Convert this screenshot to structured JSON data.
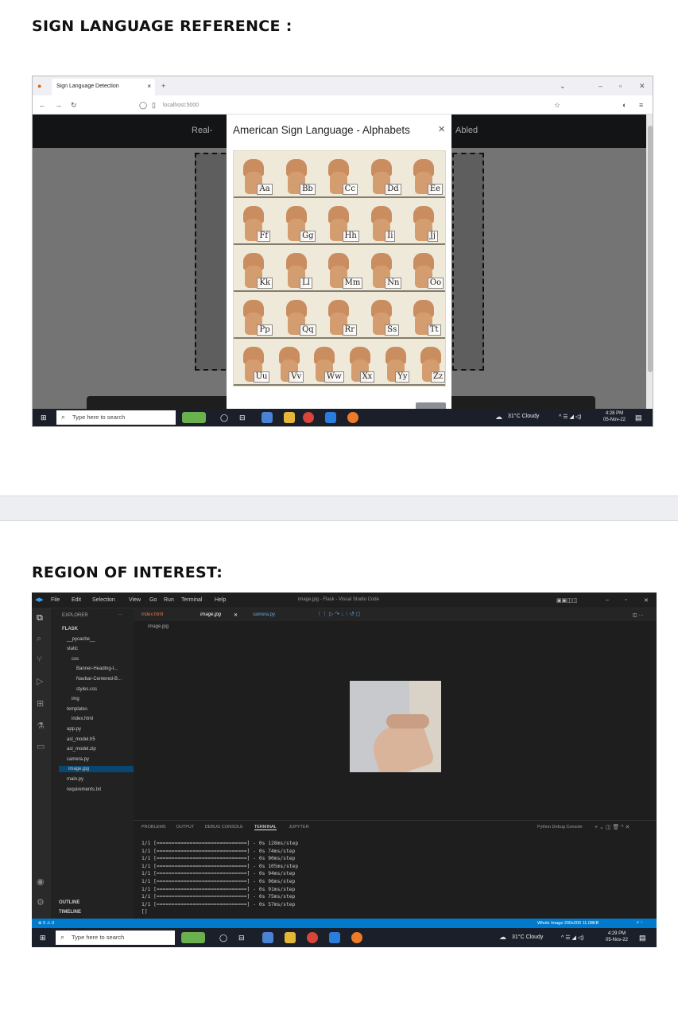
{
  "section1": {
    "heading": "SIGN LANGUAGE REFERENCE :"
  },
  "section2": {
    "heading": "REGION OF INTEREST:"
  },
  "browser": {
    "tab_title": "Sign Language Detection",
    "tab_close": "×",
    "new_tab": "+",
    "url": "localhost:5000",
    "app_left": "Real-",
    "app_right": "Abled",
    "modal": {
      "title": "American Sign Language - Alphabets",
      "close": "×",
      "rows": [
        [
          "Aa",
          "Bb",
          "Cc",
          "Dd",
          "Ee"
        ],
        [
          "Ff",
          "Gg",
          "Hh",
          "Ii",
          "Jj"
        ],
        [
          "Kk",
          "Ll",
          "Mm",
          "Nn",
          "Oo"
        ],
        [
          "Pp",
          "Qq",
          "Rr",
          "Ss",
          "Tt"
        ],
        [
          "Uu",
          "Vv",
          "Ww",
          "Xx",
          "Yy",
          "Zz"
        ]
      ]
    }
  },
  "taskbar1": {
    "search": "Type here to search",
    "weather": "31°C  Cloudy",
    "time": "4:28 PM",
    "date": "05-Nov-22"
  },
  "vscode": {
    "menu": [
      "File",
      "Edit",
      "Selection",
      "View",
      "Go",
      "Run",
      "Terminal",
      "Help"
    ],
    "window_title": "image.jpg - Flask - Visual Studio Code",
    "explorer_label": "EXPLORER",
    "tree": [
      {
        "t": "FLASK",
        "d": 0
      },
      {
        "t": "__pycache__",
        "d": 1
      },
      {
        "t": "static",
        "d": 1
      },
      {
        "t": "css",
        "d": 2
      },
      {
        "t": "Banner-Heading-I...",
        "d": 3
      },
      {
        "t": "Navbar-Centered-B...",
        "d": 3
      },
      {
        "t": "styles.css",
        "d": 3
      },
      {
        "t": "img",
        "d": 2
      },
      {
        "t": "templates",
        "d": 1
      },
      {
        "t": "index.html",
        "d": 2
      },
      {
        "t": "app.py",
        "d": 1
      },
      {
        "t": "asl_model.h5",
        "d": 1
      },
      {
        "t": "asl_model.zip",
        "d": 1
      },
      {
        "t": "camera.py",
        "d": 1
      },
      {
        "t": "image.jpg",
        "d": 1
      },
      {
        "t": "main.py",
        "d": 1
      },
      {
        "t": "requirements.txt",
        "d": 1
      }
    ],
    "outline": "OUTLINE",
    "timeline": "TIMELINE",
    "tabs": [
      "index.html",
      "image.jpg",
      "camera.py"
    ],
    "breadcrumb": "image.jpg",
    "panel_tabs": [
      "PROBLEMS",
      "OUTPUT",
      "DEBUG CONSOLE",
      "TERMINAL",
      "JUPYTER"
    ],
    "debug_console": "Python Debug Console",
    "terminal": [
      "1/1 [==============================] - 0s 128ms/step",
      "1/1 [==============================] - 0s 74ms/step",
      "1/1 [==============================] - 0s 90ms/step",
      "1/1 [==============================] - 0s 105ms/step",
      "1/1 [==============================] - 0s 94ms/step",
      "1/1 [==============================] - 0s 96ms/step",
      "1/1 [==============================] - 0s 91ms/step",
      "1/1 [==============================] - 0s 75ms/step",
      "1/1 [==============================] - 0s 57ms/step",
      "[]"
    ],
    "status_left": "⊗ 0 ⚠ 0",
    "status_right": "Whole Image   200x200   11.08KB"
  },
  "taskbar2": {
    "search": "Type here to search",
    "weather": "31°C  Cloudy",
    "time": "4:29 PM",
    "date": "05-Nov-22"
  }
}
